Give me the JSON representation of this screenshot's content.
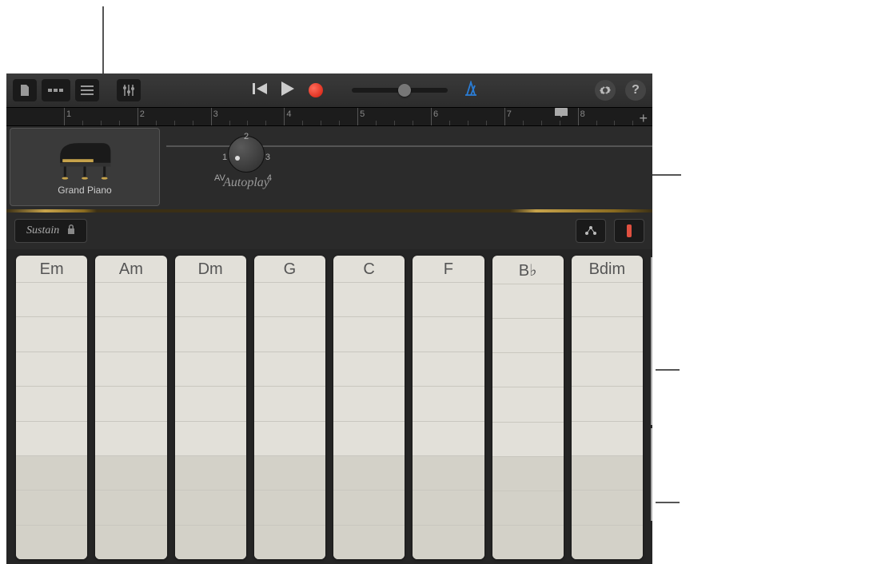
{
  "toolbar": {
    "view_tracks_icon": "tracks",
    "view_browser_icon": "browser",
    "view_editor_icon": "editor",
    "mixer_icon": "mixer"
  },
  "transport": {
    "rewind": "rewind",
    "play": "play",
    "record": "record",
    "metronome": "metronome"
  },
  "settings_icon": "settings",
  "help_icon": "help",
  "ruler": {
    "bars": [
      "1",
      "2",
      "3",
      "4",
      "5",
      "6",
      "7",
      "8"
    ],
    "playhead_bar": 7,
    "add_track": "+"
  },
  "instrument": {
    "name": "Grand Piano"
  },
  "autoplay": {
    "label": "Autoplay",
    "marks": {
      "av": "AV",
      "p1": "1",
      "p2": "2",
      "p3": "3",
      "p4": "4"
    }
  },
  "controls": {
    "sustain_label": "Sustain"
  },
  "chords": [
    "Em",
    "Am",
    "Dm",
    "G",
    "C",
    "F",
    "B♭",
    "Bdim"
  ],
  "chord_segments": {
    "upper_rows": 5,
    "lower_rows": 3
  }
}
